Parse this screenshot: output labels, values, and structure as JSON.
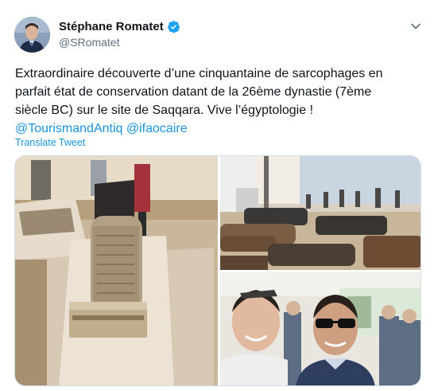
{
  "author": {
    "display_name": "Stéphane Romatet",
    "handle": "@SRomatet",
    "verified": true,
    "avatar_icon": "profile-photo",
    "verified_icon": "verified-badge-icon",
    "menu_icon": "chevron-down-icon"
  },
  "tweet": {
    "lines": [
      "Extraordinaire découverte d’une cinquantaine de sarcophages en",
      "parfait état de conservation datant de la 26ème dynastie (7ème",
      "siècle BC) sur le site de Saqqara. Vive l’égyptologie !"
    ],
    "mentions": [
      "@TourismandAntiq",
      "@ifaocaire"
    ],
    "translate_label": "Translate Tweet"
  },
  "media": {
    "photos": [
      "photo-sarcophagus-closeup",
      "photo-sarcophagi-tent",
      "photo-selfie"
    ]
  },
  "colors": {
    "link": "#1b95e0",
    "text": "#0f1419",
    "secondary": "#5b7083",
    "verified": "#1da1f2"
  }
}
